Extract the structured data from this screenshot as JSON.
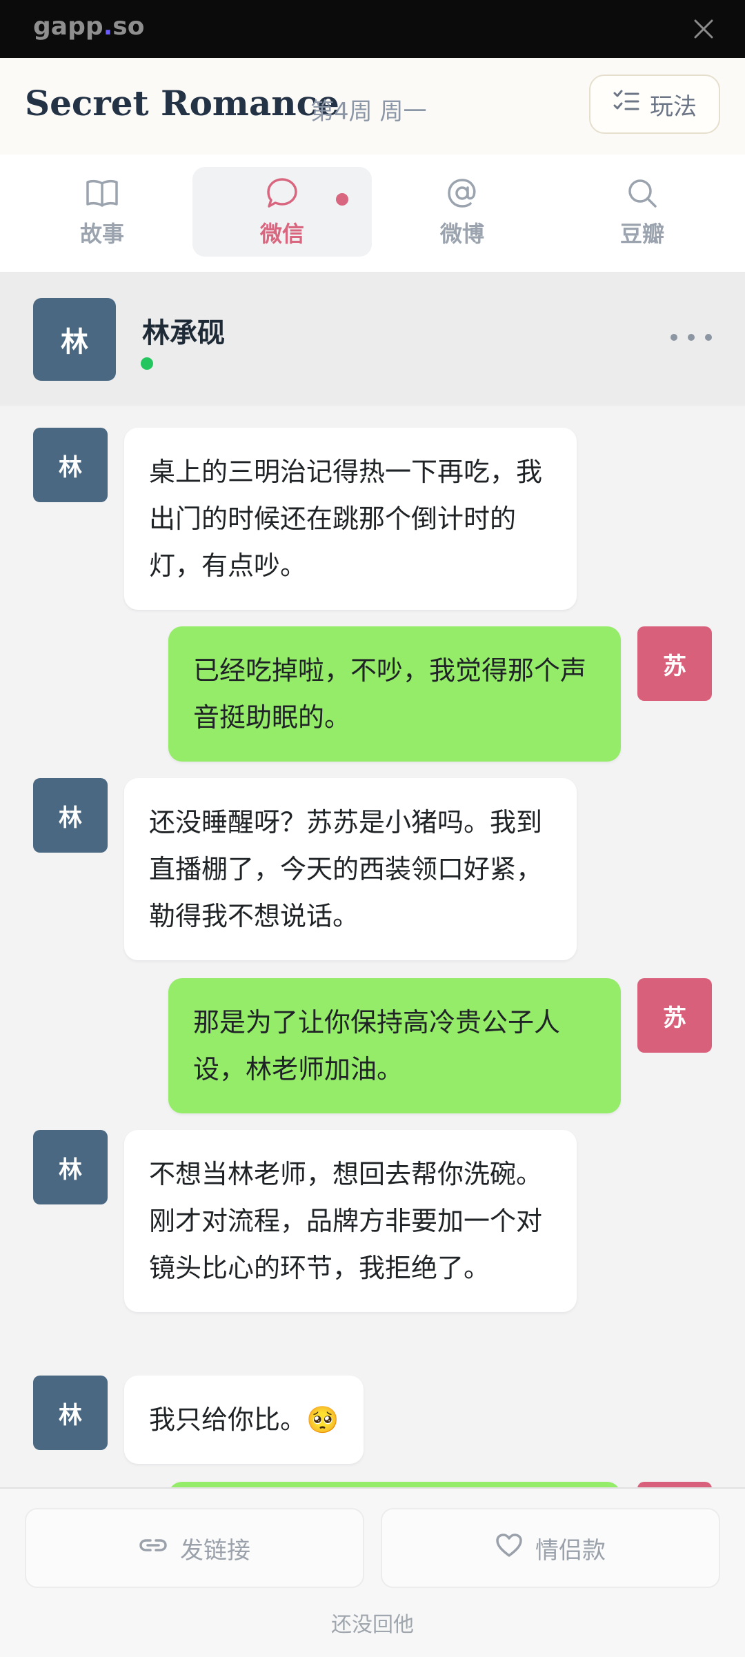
{
  "topbar": {
    "brand_a": "gapp",
    "brand_dot": ".",
    "brand_b": "so"
  },
  "header": {
    "title": "Secret Romance",
    "week": "第4周 周一",
    "rules_label": "玩法"
  },
  "tabs": [
    {
      "label": "故事",
      "icon": "book-icon"
    },
    {
      "label": "微信",
      "icon": "chat-bubble-icon",
      "active": true,
      "unread": true
    },
    {
      "label": "微博",
      "icon": "at-icon"
    },
    {
      "label": "豆瓣",
      "icon": "search-icon"
    }
  ],
  "chat": {
    "avatar": "林",
    "name": "林承砚",
    "status": "online"
  },
  "messages": [
    {
      "from": "lin",
      "avatar": "林",
      "text": "桌上的三明治记得热一下再吃，我出门的时候还在跳那个倒计时的灯，有点吵。"
    },
    {
      "from": "su",
      "avatar": "苏",
      "text": "已经吃掉啦，不吵，我觉得那个声音挺助眠的。"
    },
    {
      "from": "lin",
      "avatar": "林",
      "text": "还没睡醒呀？苏苏是小猪吗。我到直播棚了，今天的西装领口好紧，勒得我不想说话。"
    },
    {
      "from": "su",
      "avatar": "苏",
      "text": "那是为了让你保持高冷贵公子人设，林老师加油。"
    },
    {
      "from": "lin",
      "avatar": "林",
      "text": "不想当林老师，想回去帮你洗碗。刚才对流程，品牌方非要加一个对镜头比心的环节，我拒绝了。"
    },
    {
      "from": "lin",
      "avatar": "林",
      "text": "我只给你比。🥺"
    }
  ],
  "footer": {
    "link_label": "发链接",
    "couple_label": "情侣款",
    "status": "还没回他"
  },
  "colors": {
    "accent": "#d9667f",
    "lin_avatar": "#4a6882",
    "su_avatar": "#d9607a",
    "out_bubble": "#95ec69"
  }
}
